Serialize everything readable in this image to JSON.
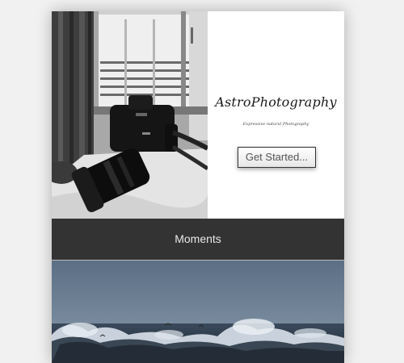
{
  "hero": {
    "title": "AstroPhotography",
    "tagline": "Expressive natural Photography",
    "cta_label": "Get Started..."
  },
  "section": {
    "title": "Moments"
  },
  "images": {
    "hero_photo": "camera-on-bed-photo",
    "ocean_photo": "stormy-ocean-waves-photo"
  }
}
